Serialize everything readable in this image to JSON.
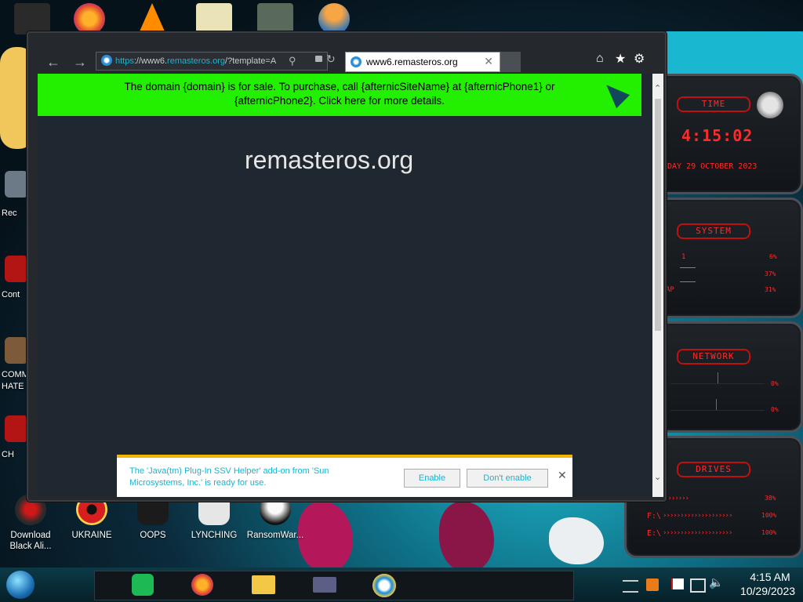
{
  "desktop": {
    "left_labels": [
      "Rec",
      "Cont",
      "COMM",
      "HATE",
      "CH"
    ],
    "bottom_icons": [
      {
        "label": "Download Black Ali...",
        "icon": "alien-skull-icon"
      },
      {
        "label": "UKRAINE",
        "icon": "radiation-icon"
      },
      {
        "label": "OOPS",
        "icon": "hooded-figure-icon"
      },
      {
        "label": "LYNCHING",
        "icon": "character-icon"
      },
      {
        "label": "RansomWar...",
        "icon": "skull-icon"
      }
    ],
    "top_icons": [
      "firefox-icon",
      "vlc-icon",
      "hxd-icon",
      "app-icon",
      "user-icon"
    ]
  },
  "widget": {
    "time_title": "TIME",
    "time_value": "4:15:02",
    "date_value": "DAY 29 OCTOBER 2023",
    "system_title": "SYSTEM",
    "system_values": [
      "6%",
      "37%",
      "31%"
    ],
    "system_labels": [
      "1",
      "",
      "AP"
    ],
    "network_title": "NETWORK",
    "network_values": [
      "0%",
      "0%"
    ],
    "drives_title": "DRIVES",
    "drives_values": [
      "38%",
      "100%",
      "100%"
    ],
    "drives_labels": [
      "",
      "F:\\",
      "E:\\"
    ],
    "colors": {
      "accent": "#ff2a2a"
    }
  },
  "browser": {
    "address": "https://www6.remasteros.org/?template=A",
    "address_scheme": "https",
    "address_prefix": "://www6.",
    "address_domain": "remasteros.org",
    "address_suffix": "/?template=A",
    "tab_title": "www6.remasteros.org",
    "banner_text": "The domain {domain} is for sale. To purchase, call {afternicSiteName} at {afternicPhone1} or {afternicPhone2}. Click here for more details.",
    "page_heading": "remasteros.org",
    "notification": {
      "text": "The 'Java(tm) Plug-In SSV Helper' add-on from 'Sun Microsystems, Inc.' is ready for use.",
      "enable_label": "Enable",
      "dont_enable_label": "Don't enable"
    }
  },
  "taskbar": {
    "time": "4:15 AM",
    "date": "10/29/2023",
    "apps": [
      "spotify-icon",
      "firefox-icon",
      "file-explorer-icon",
      "ie-icon"
    ]
  }
}
